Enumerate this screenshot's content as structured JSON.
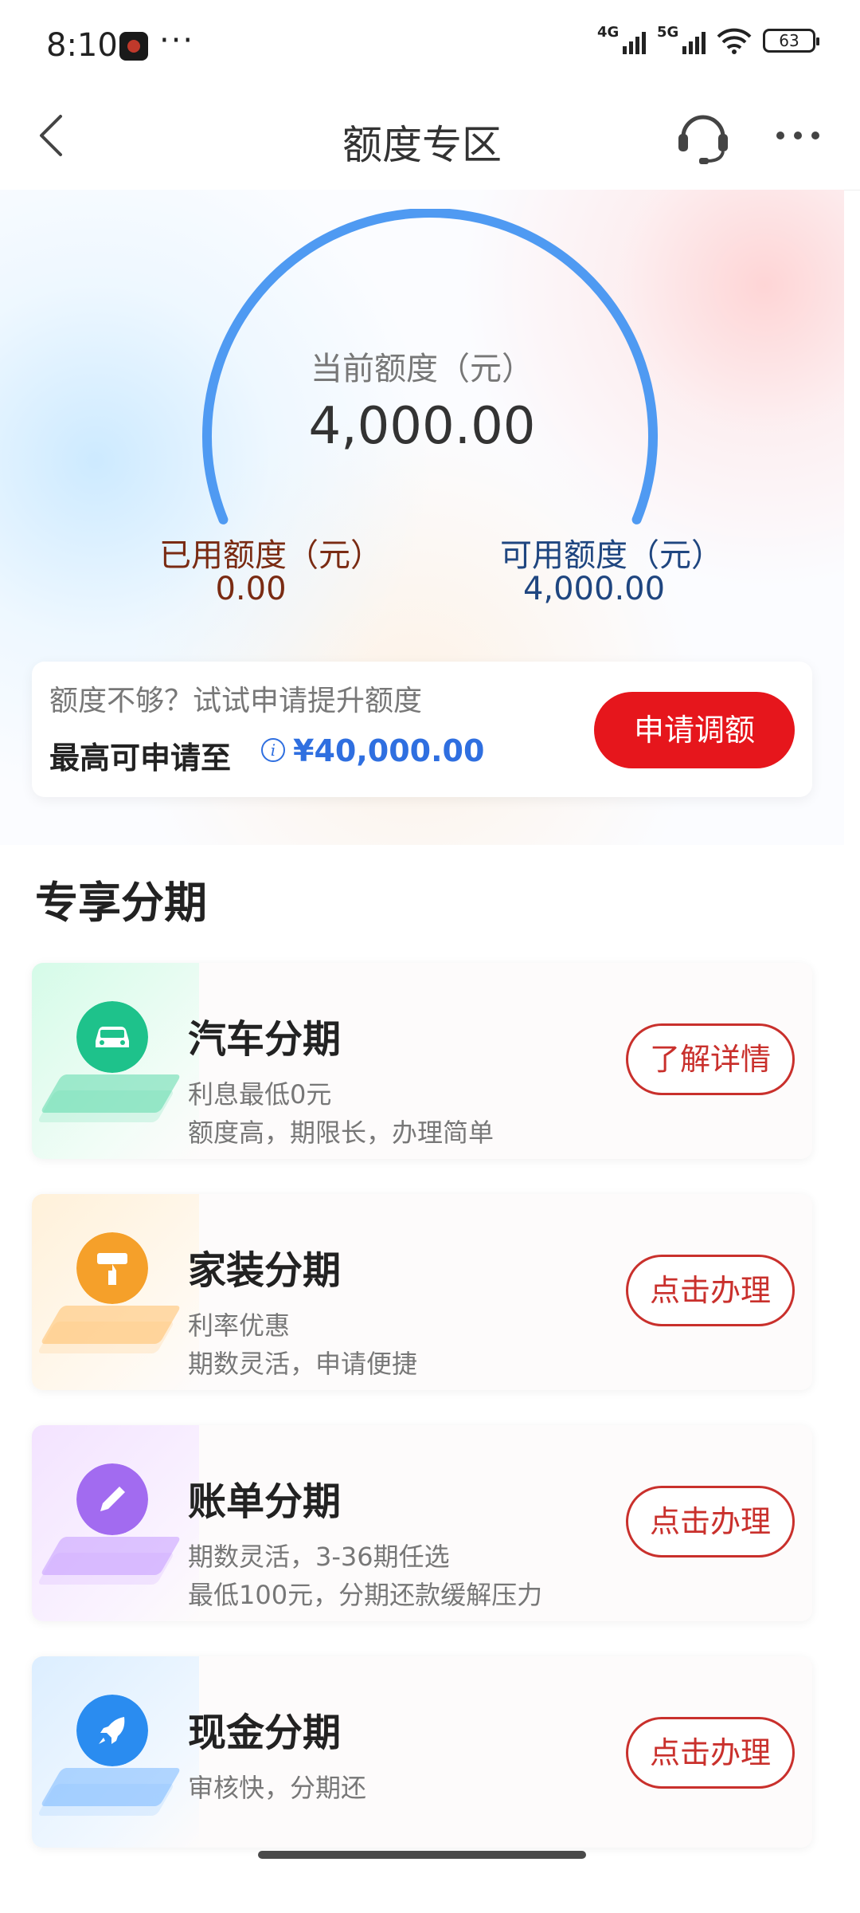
{
  "status_bar": {
    "time": "8:10",
    "signal_4g": "4G",
    "signal_5g": "5G",
    "battery": "63"
  },
  "nav": {
    "title": "额度专区"
  },
  "quota": {
    "current_label": "当前额度（元）",
    "current_value": "4,000.00",
    "used_label": "已用额度（元）",
    "used_value": "0.00",
    "available_label": "可用额度（元）",
    "available_value": "4,000.00",
    "gauge_fill_fraction": 1.0,
    "gauge_color": "#4f9af2"
  },
  "raise": {
    "tip": "额度不够？试试申请提升额度",
    "max_label": "最高可申请至",
    "max_amount": "¥40,000.00",
    "button": "申请调额",
    "button_color": "#e6161c"
  },
  "section": {
    "title": "专享分期"
  },
  "installments": [
    {
      "title": "汽车分期",
      "line1": "利息最低0元",
      "line2": "额度高，期限长，办理简单",
      "button": "了解详情",
      "icon": "car-icon",
      "color": "#1ec28b"
    },
    {
      "title": "家装分期",
      "line1": "利率优惠",
      "line2": "期数灵活，申请便捷",
      "button": "点击办理",
      "icon": "paint-roller-icon",
      "color": "#f5a02a"
    },
    {
      "title": "账单分期",
      "line1": "期数灵活，3-36期任选",
      "line2": "最低100元，分期还款缓解压力",
      "button": "点击办理",
      "icon": "pencil-icon",
      "color": "#a26bf0"
    },
    {
      "title": "现金分期",
      "line1": "审核快，分期还",
      "line2": "",
      "button": "点击办理",
      "icon": "rocket-icon",
      "color": "#2a8cf0"
    }
  ]
}
